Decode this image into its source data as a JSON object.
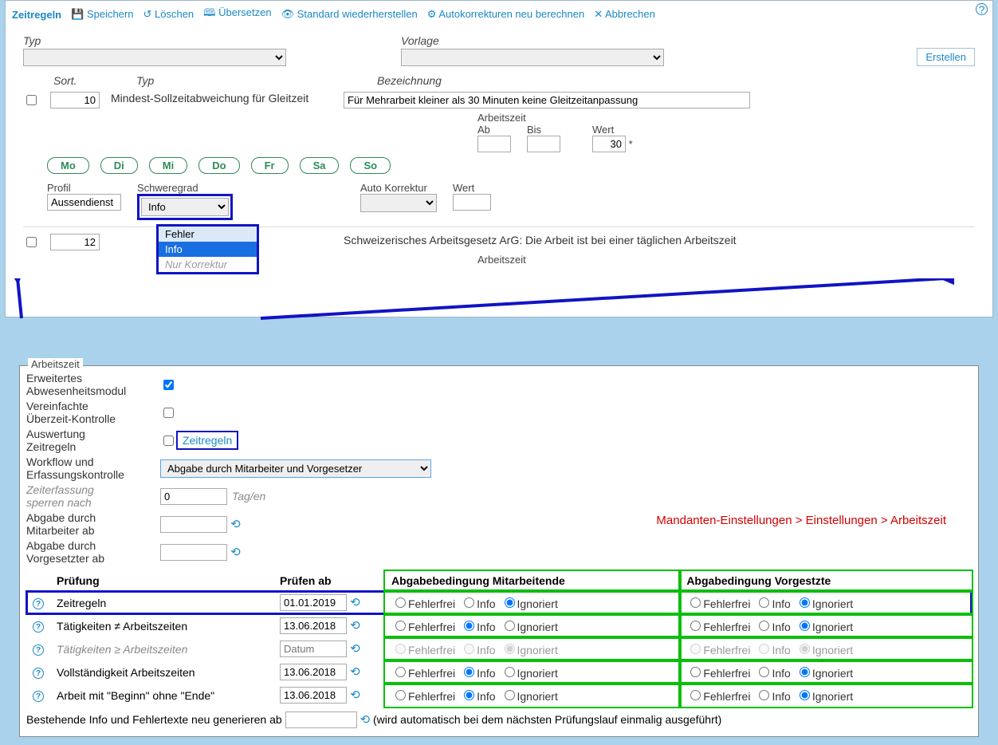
{
  "topbar": {
    "title": "Zeitregeln",
    "actions": {
      "save": "Speichern",
      "delete": "Löschen",
      "translate": "Übersetzen",
      "restore": "Standard wiederherstellen",
      "recalc": "Autokorrekturen neu berechnen",
      "cancel": "Abbrechen"
    }
  },
  "filter": {
    "type_label": "Typ",
    "template_label": "Vorlage",
    "create_btn": "Erstellen"
  },
  "listhdr": {
    "sort": "Sort.",
    "typ": "Typ",
    "bez": "Bezeichnung"
  },
  "row1": {
    "sort": "10",
    "typ": "Mindest-Sollzeitabweichung für Gleitzeit",
    "bez": "Für Mehrarbeit kleiner als 30 Minuten keine Gleitzeitanpassung",
    "arbeit_lbl": "Arbeitszeit",
    "ab_lbl": "Ab",
    "bis_lbl": "Bis",
    "wert_lbl": "Wert",
    "wert_val": "30",
    "star": "*",
    "days": {
      "mo": "Mo",
      "di": "Di",
      "mi": "Mi",
      "do": "Do",
      "fr": "Fr",
      "sa": "Sa",
      "so": "So"
    },
    "profil_lbl": "Profil",
    "profil_val": "Aussendienst",
    "schwer_lbl": "Schweregrad",
    "schwer_val": "Info",
    "autokorr_lbl": "Auto Korrektur",
    "wert2_lbl": "Wert",
    "dropdown": {
      "opt_fehler": "Fehler",
      "opt_info": "Info",
      "opt_nurkorr": "Nur Korrektur"
    }
  },
  "row2": {
    "sort": "12",
    "bez": "Schweizerisches Arbeitsgesetz ArG: Die Arbeit ist bei einer täglichen Arbeitszeit",
    "arbeit_lbl": "Arbeitszeit"
  },
  "panel2": {
    "legend": "Arbeitszeit",
    "rows": {
      "erwabw_1": "Erweitertes",
      "erwabw_2": "Abwesenheitsmodul",
      "verein_1": "Vereinfachte",
      "verein_2": "Überzeit-Kontrolle",
      "auswert_1": "Auswertung",
      "auswert_2": "Zeitregeln",
      "zeitregeln_link": "Zeitregeln",
      "workflow_1": "Workflow und",
      "workflow_2": "Erfassungskontrolle",
      "workflow_val": "Abgabe durch Mitarbeiter und Vorgesetzer",
      "sperr_1": "Zeiterfassung",
      "sperr_2": "sperren nach",
      "sperr_val": "0",
      "sperr_unit": "Tag/en",
      "abMit_1": "Abgabe durch",
      "abMit_2": "Mitarbeiter ab",
      "abVor_1": "Abgabe durch",
      "abVor_2": "Vorgesetzter ab"
    },
    "breadcrumb": "Mandanten-Einstellungen > Einstellungen > Arbeitszeit",
    "table": {
      "h_pruef": "Prüfung",
      "h_ab": "Prüfen ab",
      "h_mit": "Abgabebedingung Mitarbeitende",
      "h_vor": "Abgabedingung Vorgestzte",
      "radio_ff": "Fehlerfrei",
      "radio_info": "Info",
      "radio_ign": "Ignoriert",
      "date_placeholder": "Datum",
      "rows": [
        {
          "name": "Zeitregeln",
          "date": "01.01.2019",
          "mit": "Ignoriert",
          "vor": "Ignoriert",
          "disabled": false
        },
        {
          "name": "Tätigkeiten ≠ Arbeitszeiten",
          "date": "13.06.2018",
          "mit": "Info",
          "vor": "Ignoriert",
          "disabled": false
        },
        {
          "name": "Tätigkeiten ≥ Arbeitszeiten",
          "date": "",
          "mit": "Ignoriert",
          "vor": "Ignoriert",
          "disabled": true
        },
        {
          "name": "Vollständigkeit Arbeitszeiten",
          "date": "13.06.2018",
          "mit": "Info",
          "vor": "Ignoriert",
          "disabled": false
        },
        {
          "name": "Arbeit mit \"Beginn\" ohne \"Ende\"",
          "date": "13.06.2018",
          "mit": "Info",
          "vor": "Ignoriert",
          "disabled": false
        }
      ]
    },
    "footer": {
      "label": "Bestehende Info und Fehlertexte neu generieren ab",
      "note": "(wird automatisch bei dem nächsten Prüfungslauf einmalig ausgeführt)"
    }
  }
}
